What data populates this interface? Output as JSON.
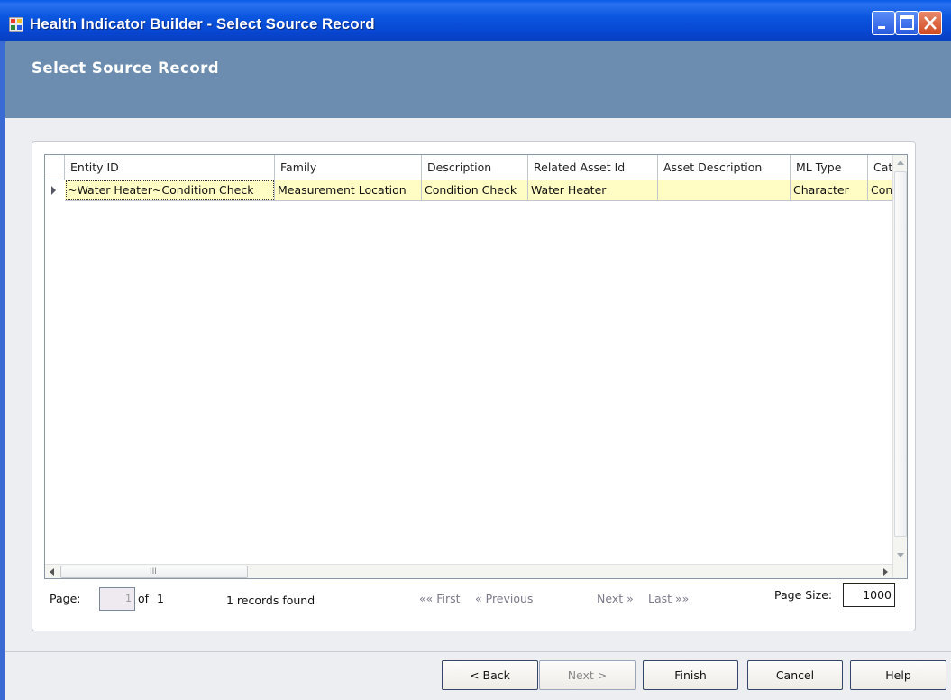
{
  "window": {
    "title": "Health Indicator Builder - Select Source Record"
  },
  "header": {
    "title": "Select Source Record"
  },
  "grid": {
    "columns": [
      "Entity ID",
      "Family",
      "Description",
      "Related Asset Id",
      "Asset Description",
      "ML Type",
      "Cate"
    ],
    "rows": [
      [
        "~Water Heater~Condition Check",
        "Measurement Location",
        "Condition Check",
        "Water Heater",
        "",
        "Character",
        "Conc"
      ]
    ],
    "hscroll_grip": "III"
  },
  "pager": {
    "page_label": "Page:",
    "page_value": "1",
    "of_label": "of",
    "total_pages": "1",
    "records_found": "1 records found",
    "first": "«« First",
    "previous": "« Previous",
    "next": "Next »",
    "last": "Last »»",
    "page_size_label": "Page Size:",
    "page_size_value": "1000"
  },
  "buttons": {
    "back": "< Back",
    "next": "Next >",
    "finish": "Finish",
    "cancel": "Cancel",
    "help": "Help"
  },
  "icons": {
    "app": "app-icon",
    "minimize": "minimize-icon",
    "maximize": "maximize-icon",
    "close": "close-icon"
  },
  "colors": {
    "title_bar": "#0a50dc",
    "header_band": "#6d8db0",
    "selected_row": "#fffdc4"
  }
}
